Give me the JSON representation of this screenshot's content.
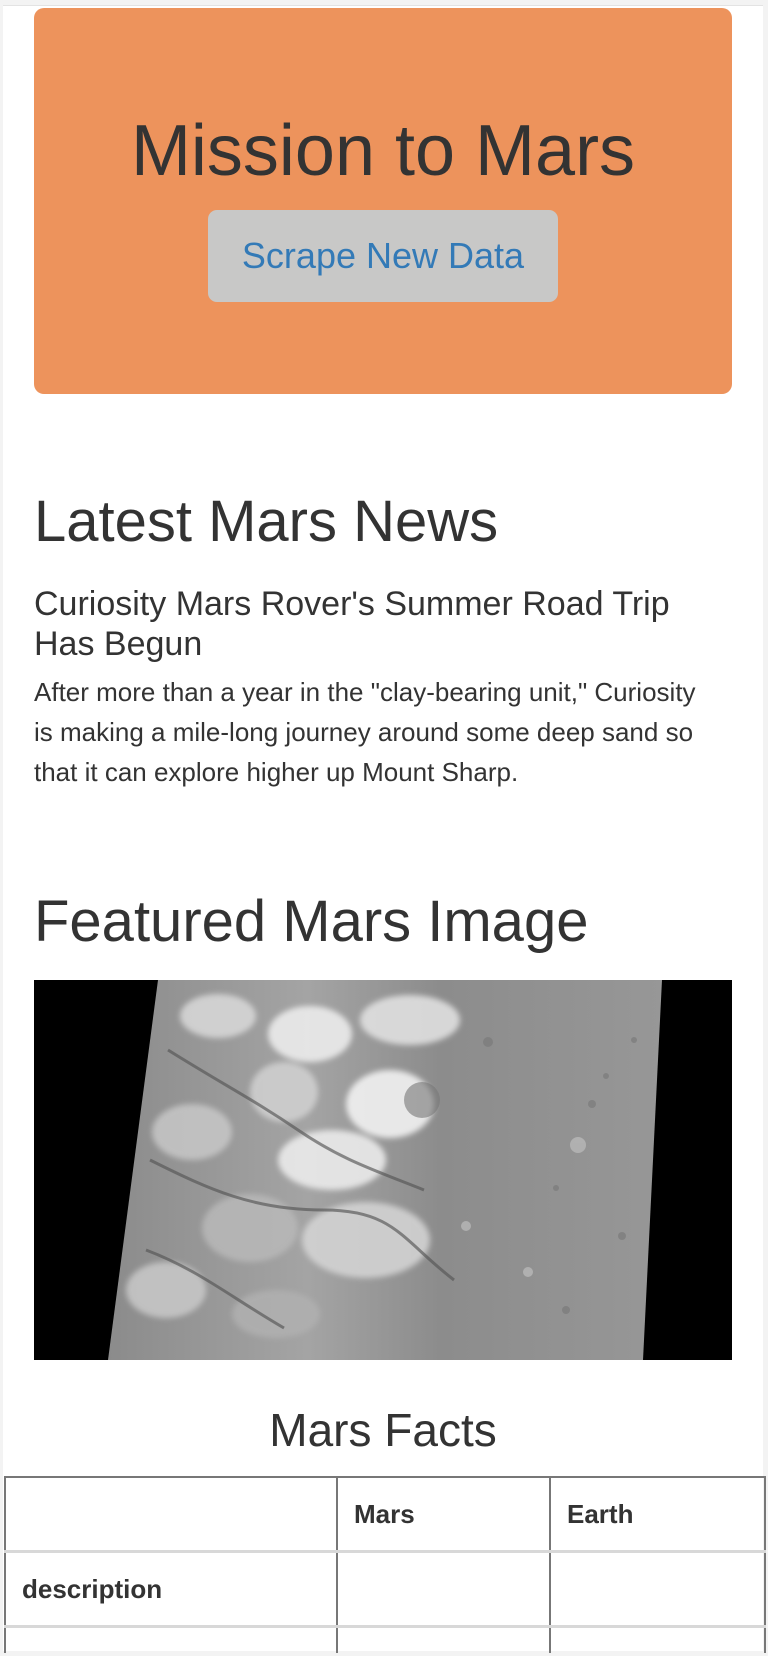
{
  "hero": {
    "title": "Mission to Mars",
    "button_label": "Scrape New Data"
  },
  "news": {
    "heading": "Latest Mars News",
    "title": "Curiosity Mars Rover's Summer Road Trip Has Begun",
    "body": "After more than a year in the \"clay-bearing unit,\" Curiosity is making a mile-long journey around some deep sand so that it can explore higher up Mount Sharp."
  },
  "featured_image": {
    "heading": "Featured Mars Image"
  },
  "facts": {
    "heading": "Mars Facts",
    "columns": [
      "",
      "Mars",
      "Earth"
    ],
    "rows": [
      [
        "description",
        "",
        ""
      ],
      [
        "",
        "",
        ""
      ]
    ]
  },
  "colors": {
    "hero_background": "#ed935c",
    "button_background": "#c8c8c7",
    "button_text": "#337ab7",
    "text": "#333333"
  }
}
